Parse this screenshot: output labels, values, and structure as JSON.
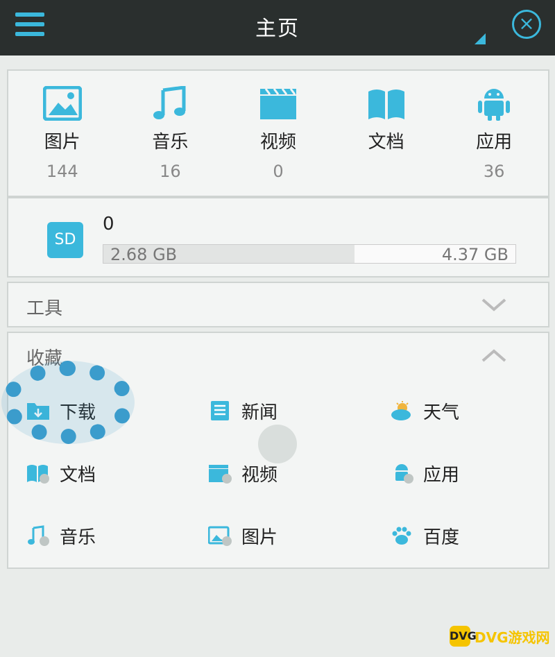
{
  "header": {
    "title": "主页",
    "close_glyph": "×"
  },
  "categories": [
    {
      "label": "图片",
      "count": "144",
      "icon": "image-icon"
    },
    {
      "label": "音乐",
      "count": "16",
      "icon": "music-icon"
    },
    {
      "label": "视频",
      "count": "0",
      "icon": "video-icon"
    },
    {
      "label": "文档",
      "count": "",
      "icon": "document-icon"
    },
    {
      "label": "应用",
      "count": "36",
      "icon": "android-icon"
    }
  ],
  "storage": {
    "badge": "SD",
    "name": "0",
    "used": "2.68 GB",
    "total": "4.37 GB",
    "used_fraction": 0.61
  },
  "tools": {
    "label": "工具",
    "expanded": false
  },
  "favorites": {
    "label": "收藏",
    "expanded": true,
    "items": [
      {
        "label": "下载",
        "icon": "download-folder-icon"
      },
      {
        "label": "新闻",
        "icon": "news-icon"
      },
      {
        "label": "天气",
        "icon": "weather-icon"
      },
      {
        "label": "文档",
        "icon": "document-icon"
      },
      {
        "label": "视频",
        "icon": "video-icon"
      },
      {
        "label": "应用",
        "icon": "android-icon"
      },
      {
        "label": "音乐",
        "icon": "music-icon"
      },
      {
        "label": "图片",
        "icon": "image-icon"
      },
      {
        "label": "百度",
        "icon": "paw-icon"
      }
    ]
  },
  "watermark": {
    "icon_text": "DVG",
    "text": "DVG游戏网"
  },
  "colors": {
    "accent": "#3bb8dc",
    "topbar": "#2a2f2e",
    "highlight": "#3b9ccc"
  }
}
